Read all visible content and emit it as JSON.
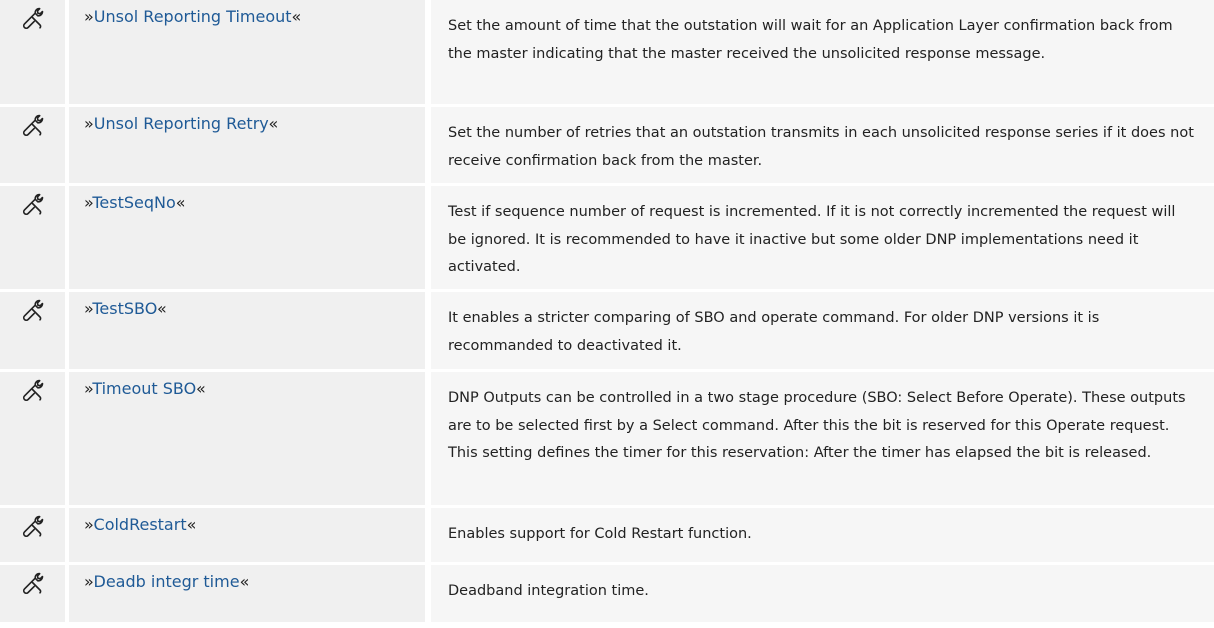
{
  "rows": [
    {
      "name": "Unsol Reporting Timeout",
      "desc": "Set the amount of time that the outstation will wait for an Application Layer confirmation back from the master indicating that the master received the unsolicited response message."
    },
    {
      "name": "Unsol Reporting Retry",
      "desc": "Set the number of retries that an outstation transmits in each unsolicited response series if it does not receive confirmation back from the master."
    },
    {
      "name": "TestSeqNo",
      "desc": "Test if sequence number of request is incremented. If it is not correctly incremented the request will be ignored. It is recommended to have it inactive but some older DNP implementations need it activated."
    },
    {
      "name": "TestSBO",
      "desc": "It enables a stricter comparing of SBO and operate command. For older DNP versions it is recommanded to deactivated it."
    },
    {
      "name": "Timeout SBO",
      "desc": "DNP Outputs can be controlled in a two stage procedure (SBO: Select Before Operate). These outputs are to be selected first by a Select command. After this the bit is reserved for this Operate request. This setting defines the timer for this reservation: After the timer has elapsed the bit is released."
    },
    {
      "name": "ColdRestart",
      "desc": "Enables support for Cold Restart function."
    },
    {
      "name": "Deadb integr time",
      "desc": "Deadband integration time."
    }
  ],
  "quote_open": "»",
  "quote_close": "«",
  "icon": "wrench-icon",
  "link_color": "#1f5a96"
}
